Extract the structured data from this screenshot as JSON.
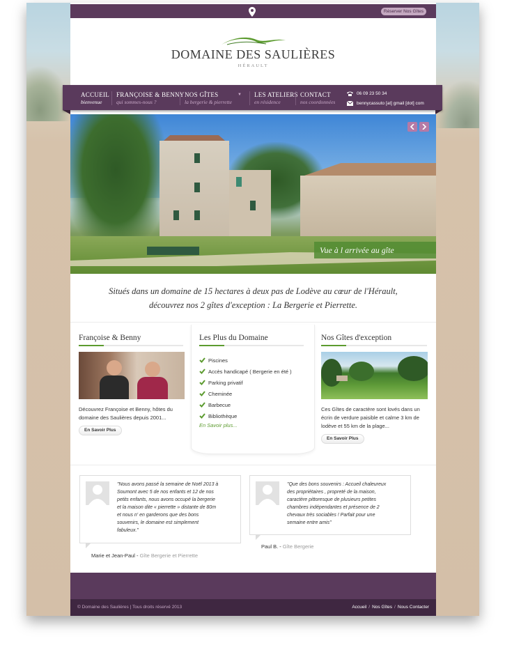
{
  "header": {
    "reserve_label": "Réserver Nos Gîtes",
    "logo_title": "DOMAINE DES SAULIÈRES",
    "logo_subtitle": "HÉRAULT"
  },
  "nav": {
    "items": [
      {
        "label": "ACCUEIL",
        "sub": "bienvenue"
      },
      {
        "label": "FRANÇOISE & BENNY",
        "sub": "qui sommes-nous ?"
      },
      {
        "label": "NOS GÎTES",
        "sub": "la bergerie & pierrette"
      },
      {
        "label": "LES ATELIERS",
        "sub": "en résidence"
      },
      {
        "label": "CONTACT",
        "sub": "nos coordonnées"
      }
    ],
    "phone": "06 09 23 50 34",
    "email": "bennycassuto [at] gmail [dot] com"
  },
  "slider": {
    "caption": "Vue à l arrivée au gîte"
  },
  "intro": {
    "line1": "Situés dans un domaine de 15 hectares à deux pas de Lodève au cœur de l'Hérault,",
    "line2": "découvrez nos 2 gîtes d'exception : La Bergerie et Pierrette."
  },
  "col1": {
    "title": "Françoise & Benny",
    "text1": "Découvrez Françoise et Benny, hôtes du",
    "text2": "domaine des Saulières depuis 2001...",
    "button": "En Savoir Plus"
  },
  "col2": {
    "title": "Les Plus du Domaine",
    "items": [
      "Piscines",
      "Accès handicapé ( Bergerie en été )",
      "Parking privatif",
      "Cheminée",
      "Barbecue",
      "Bibliothèque"
    ],
    "more": "En Savoir plus..."
  },
  "col3": {
    "title": "Nos Gîtes d'exception",
    "text1": "Ces Gîtes de caractère sont lovés dans un",
    "text2": "écrin de verdure paisible et calme 3 km de",
    "text3": "lodève et 55 km de la plage...",
    "button": "En Savoir Plus"
  },
  "testimonials": [
    {
      "lines": [
        "\"Nous avons passé la semaine de Noël 2013 à",
        "Soumont avec 5 de nos enfants et 12 de nos",
        "petits enfants, nous avons occupé la bergerie",
        "et la maison dite « pierrette » distante de 80m",
        "et nous n' en garderons que des bons",
        "souvenirs, le domaine est simplement",
        "fabuleux.\""
      ],
      "author": "Marie et Jean-Paul",
      "gite": "Gîte Bergerie et Pierrette"
    },
    {
      "lines": [
        "\"Que des bons souvenirs : Accueil chaleureux",
        "des propriétaires , propreté de la maison,",
        "caractère pittoresque de plusieurs petites",
        "chambres indépendantes et présence de 2",
        "chevaux très sociables ! Parfait pour une",
        "semaine entre amis\""
      ],
      "author": "Paul B.",
      "gite": "Gîte Bergerie"
    }
  ],
  "footer": {
    "copyright": "© Domaine des Saulières | Tous droits réservé 2013",
    "links": [
      "Accueil",
      "Nos Gîtes",
      "Nous Contacter"
    ],
    "separator": "/"
  },
  "colors": {
    "accent_purple": "#5a3a5c",
    "accent_green": "#5c9b2f",
    "footer_dark": "#3f2741"
  }
}
